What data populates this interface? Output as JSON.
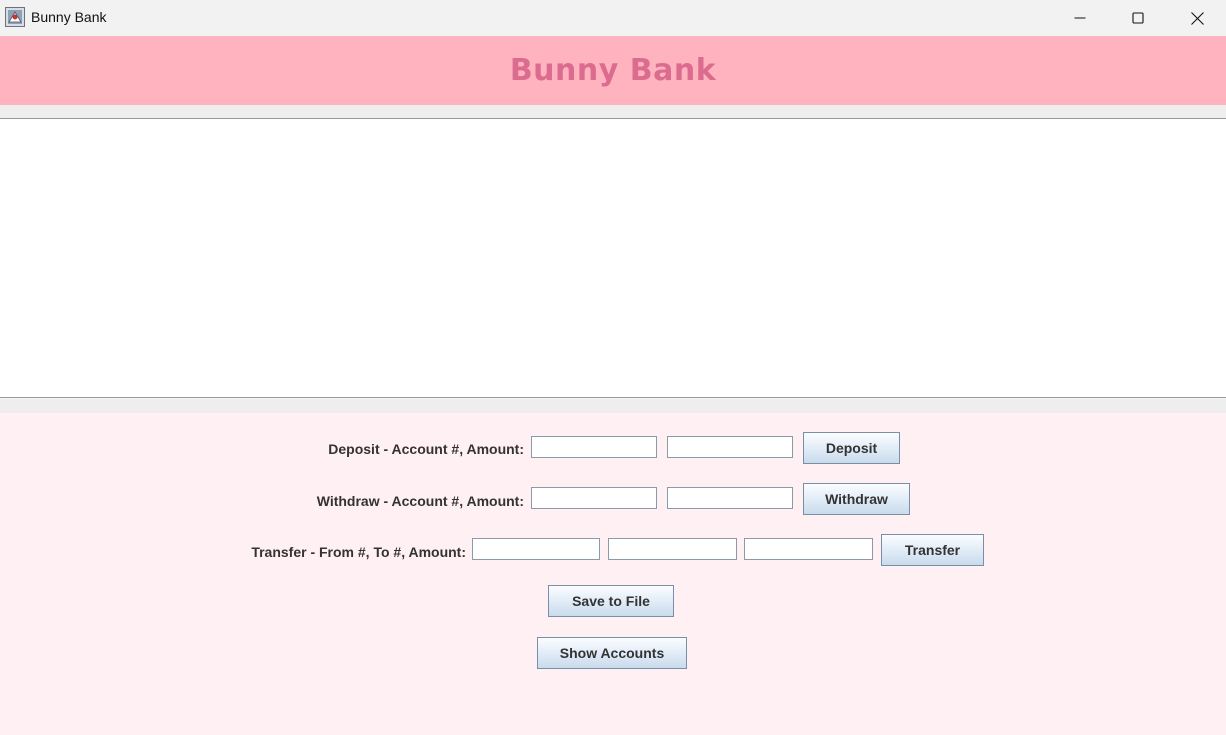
{
  "window": {
    "title": "Bunny Bank",
    "icon": "java-app-icon",
    "controls": [
      "minimize-icon",
      "maximize-icon",
      "close-icon"
    ]
  },
  "header": {
    "title": "Bunny Bank"
  },
  "output": {
    "text": ""
  },
  "deposit": {
    "label": "Deposit - Account #, Amount:",
    "account_value": "",
    "amount_value": "",
    "button": "Deposit"
  },
  "withdraw": {
    "label": "Withdraw - Account #, Amount:",
    "account_value": "",
    "amount_value": "",
    "button": "Withdraw"
  },
  "transfer": {
    "label": "Transfer - From #, To #, Amount:",
    "from_value": "",
    "to_value": "",
    "amount_value": "",
    "button": "Transfer"
  },
  "actions": {
    "save_label": "Save to File",
    "show_label": "Show Accounts"
  },
  "colors": {
    "header_bg": "#ffb3be",
    "header_text": "#dc6c8f",
    "form_bg": "#fff0f4",
    "titlebar_bg": "#f2f2f2"
  }
}
